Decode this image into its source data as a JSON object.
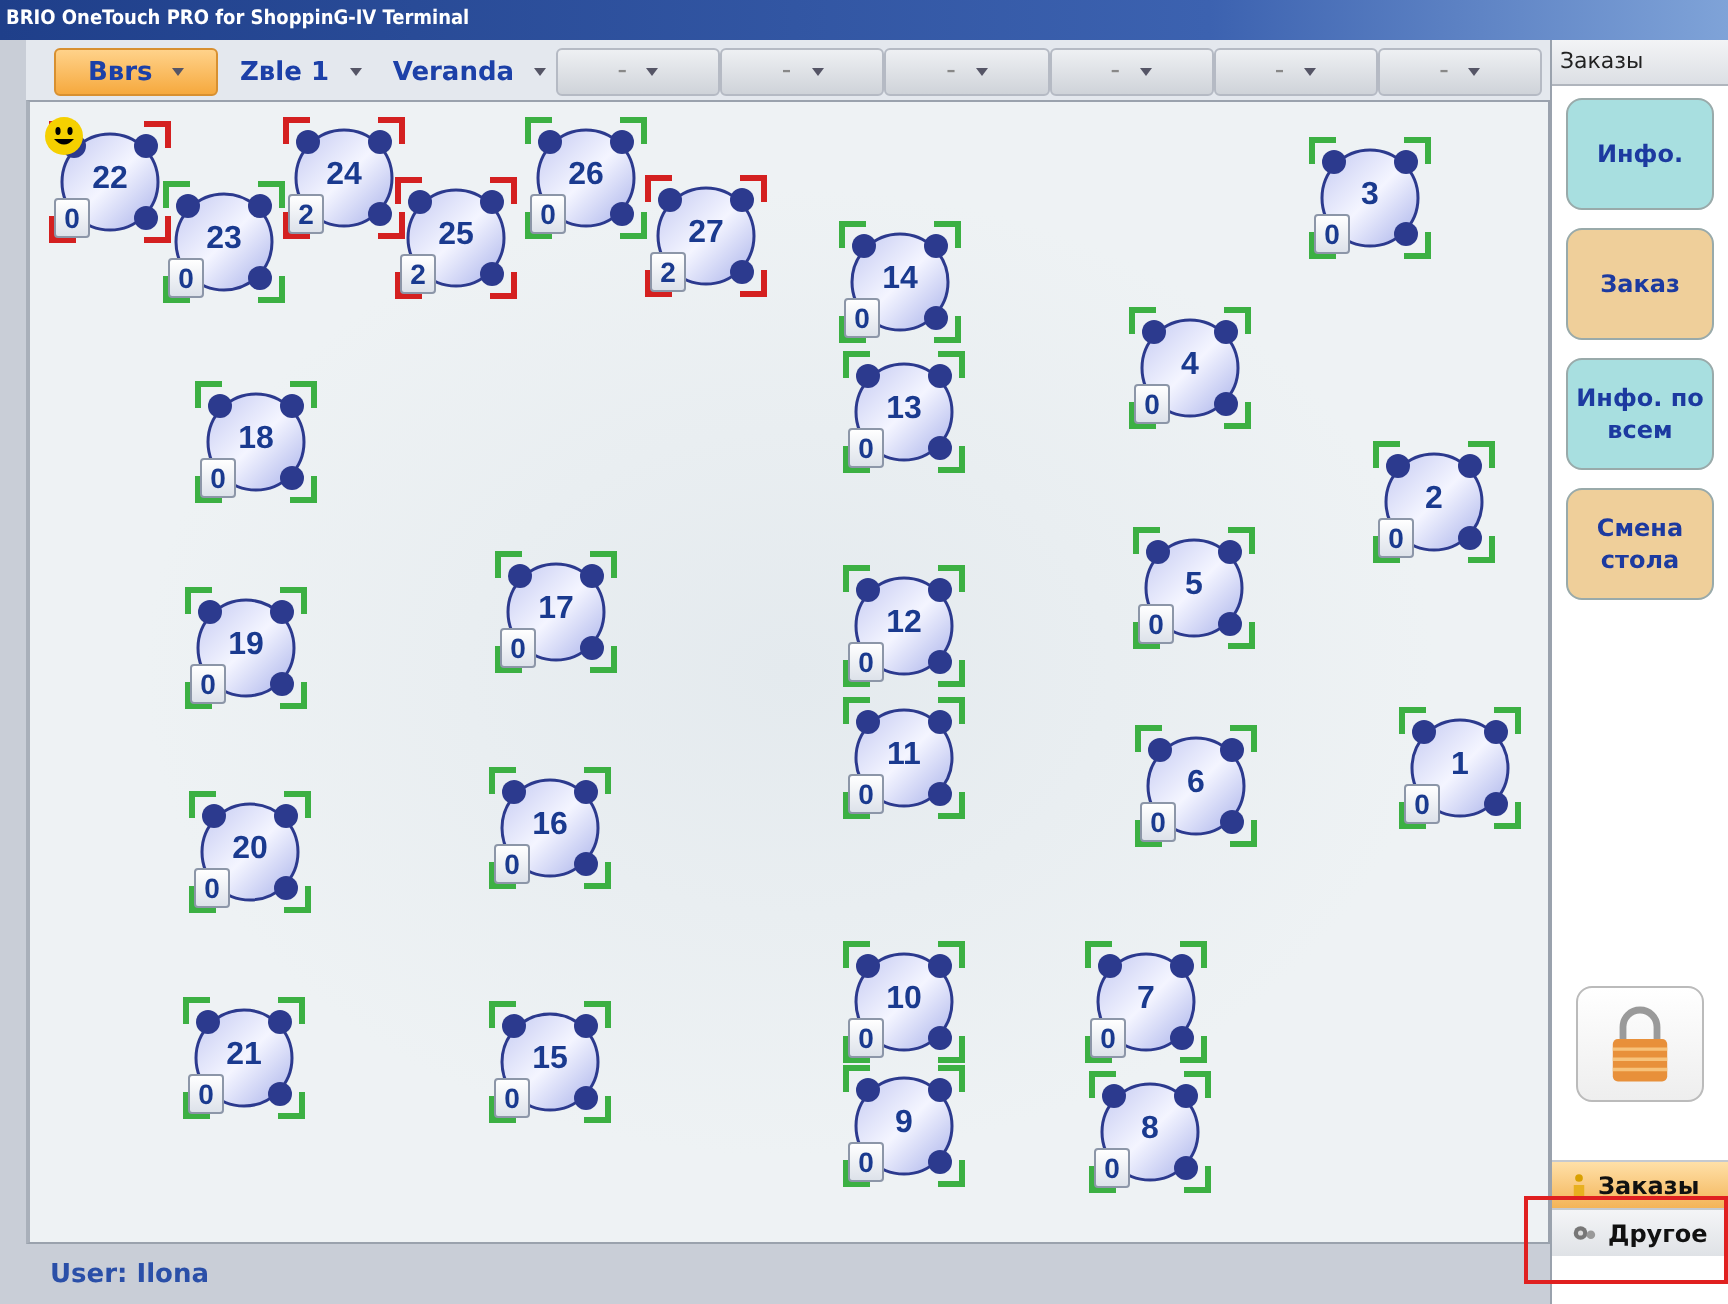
{
  "window": {
    "title": "BRIO OneTouch PRO for ShoppinG-IV Terminal"
  },
  "tabs": [
    {
      "label": "Bвrs",
      "selected": true
    },
    {
      "label": "Zвle 1",
      "selected": false
    },
    {
      "label": "Veranda",
      "selected": false
    },
    {
      "label": "–",
      "selected": false
    },
    {
      "label": "–",
      "selected": false
    },
    {
      "label": "–",
      "selected": false
    },
    {
      "label": "–",
      "selected": false
    },
    {
      "label": "–",
      "selected": false
    },
    {
      "label": "–",
      "selected": false
    }
  ],
  "tables": [
    {
      "number": "22",
      "count": "0",
      "occupied": true,
      "smiley": true
    },
    {
      "number": "23",
      "count": "0",
      "occupied": false,
      "smiley": false
    },
    {
      "number": "24",
      "count": "2",
      "occupied": true,
      "smiley": false
    },
    {
      "number": "25",
      "count": "2",
      "occupied": true,
      "smiley": false
    },
    {
      "number": "26",
      "count": "0",
      "occupied": false,
      "smiley": false
    },
    {
      "number": "27",
      "count": "2",
      "occupied": true,
      "smiley": false
    },
    {
      "number": "3",
      "count": "0",
      "occupied": false,
      "smiley": false
    },
    {
      "number": "14",
      "count": "0",
      "occupied": false,
      "smiley": false
    },
    {
      "number": "4",
      "count": "0",
      "occupied": false,
      "smiley": false
    },
    {
      "number": "13",
      "count": "0",
      "occupied": false,
      "smiley": false
    },
    {
      "number": "18",
      "count": "0",
      "occupied": false,
      "smiley": false
    },
    {
      "number": "2",
      "count": "0",
      "occupied": false,
      "smiley": false
    },
    {
      "number": "17",
      "count": "0",
      "occupied": false,
      "smiley": false
    },
    {
      "number": "5",
      "count": "0",
      "occupied": false,
      "smiley": false
    },
    {
      "number": "12",
      "count": "0",
      "occupied": false,
      "smiley": false
    },
    {
      "number": "19",
      "count": "0",
      "occupied": false,
      "smiley": false
    },
    {
      "number": "11",
      "count": "0",
      "occupied": false,
      "smiley": false
    },
    {
      "number": "1",
      "count": "0",
      "occupied": false,
      "smiley": false
    },
    {
      "number": "6",
      "count": "0",
      "occupied": false,
      "smiley": false
    },
    {
      "number": "20",
      "count": "0",
      "occupied": false,
      "smiley": false
    },
    {
      "number": "16",
      "count": "0",
      "occupied": false,
      "smiley": false
    },
    {
      "number": "10",
      "count": "0",
      "occupied": false,
      "smiley": false
    },
    {
      "number": "7",
      "count": "0",
      "occupied": false,
      "smiley": false
    },
    {
      "number": "21",
      "count": "0",
      "occupied": false,
      "smiley": false
    },
    {
      "number": "15",
      "count": "0",
      "occupied": false,
      "smiley": false
    },
    {
      "number": "9",
      "count": "0",
      "occupied": false,
      "smiley": false
    },
    {
      "number": "8",
      "count": "0",
      "occupied": false,
      "smiley": false
    }
  ],
  "status_bar": {
    "user": "User: Ilona"
  },
  "side_panel": {
    "title": "Заказы",
    "buttons": [
      {
        "label": "Инфо.",
        "kind": "info"
      },
      {
        "label": "Заказ",
        "kind": "action"
      },
      {
        "label": "Инфо. по всем",
        "kind": "info"
      },
      {
        "label": "Смена стола",
        "kind": "action"
      }
    ],
    "sections": [
      {
        "label": "Заказы",
        "selected": true,
        "kind": "orders"
      },
      {
        "label": "Другое",
        "selected": false,
        "kind": "other"
      }
    ]
  }
}
